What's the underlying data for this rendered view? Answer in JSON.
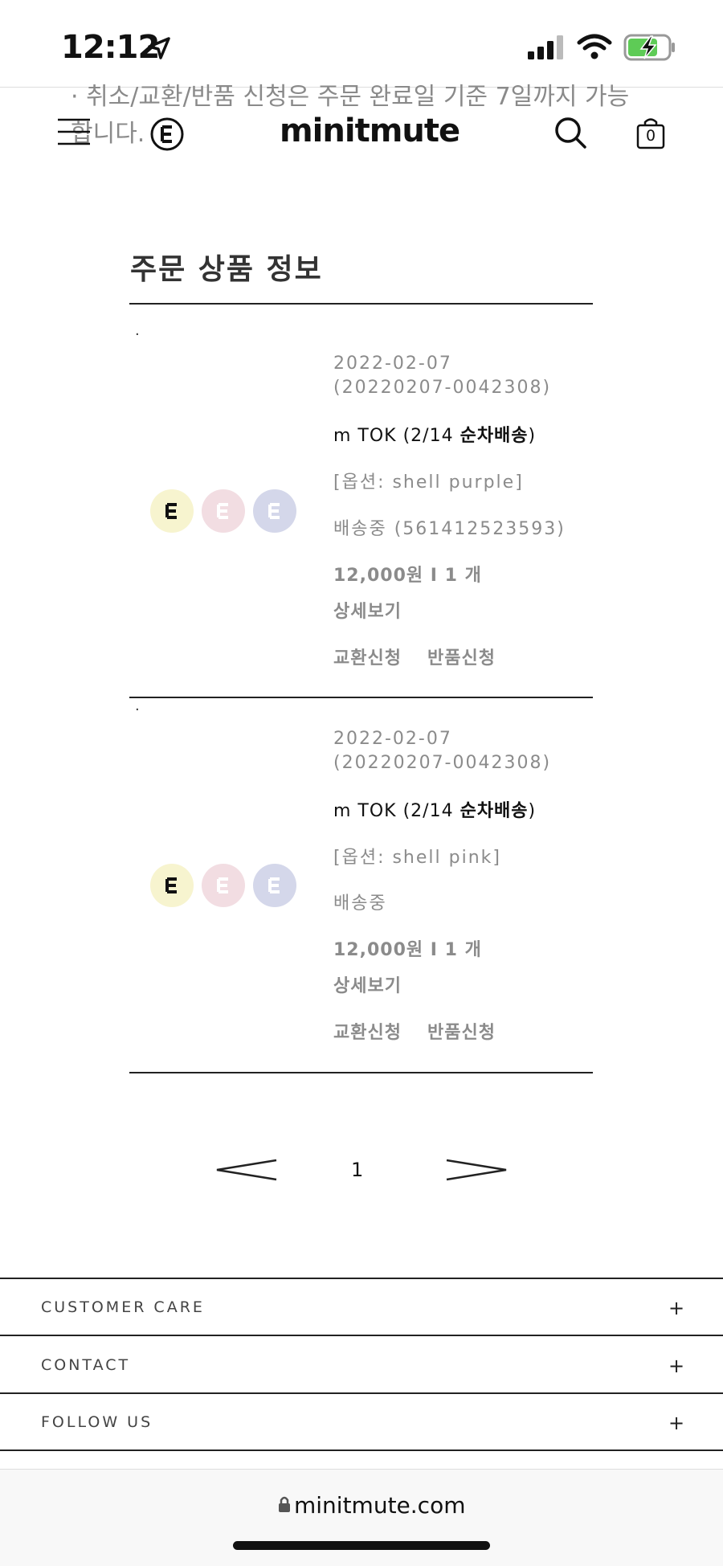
{
  "status_bar": {
    "time": "12:12"
  },
  "notice": {
    "text": "· 취소/교환/반품 신청은 주문 완료일 기준 7일까지 가능합니다."
  },
  "header": {
    "brand": "minitmute",
    "cart_count": "0"
  },
  "section": {
    "title": "주문 상품 정보"
  },
  "orders": [
    {
      "bullet": "·",
      "date": "2022-02-07",
      "order_no": "(20220207-0042308)",
      "name_prefix": "m TOK (2/14 ",
      "name_bold": "순차배송",
      "name_suffix": ")",
      "option": "[옵션: shell purple]",
      "status": "배송중 (561412523593)",
      "price_qty": "12,000원 I 1 개",
      "detail_label": "상세보기",
      "exchange_label": "교환신청",
      "return_label": "반품신청"
    },
    {
      "bullet": "·",
      "date": "2022-02-07",
      "order_no": "(20220207-0042308)",
      "name_prefix": "m TOK (2/14 ",
      "name_bold": "순차배송",
      "name_suffix": ")",
      "option": "[옵션: shell pink]",
      "status": "배송중",
      "price_qty": "12,000원 I 1 개",
      "detail_label": "상세보기",
      "exchange_label": "교환신청",
      "return_label": "반품신청"
    }
  ],
  "product_thumb": {
    "letter": "E",
    "colors": [
      "#f7f4cf",
      "#f2dde2",
      "#d4d7ea"
    ]
  },
  "pagination": {
    "current": "1"
  },
  "footer": {
    "items": [
      {
        "label": "CUSTOMER CARE",
        "icon": "+"
      },
      {
        "label": "CONTACT",
        "icon": "+"
      },
      {
        "label": "FOLLOW US",
        "icon": "+"
      }
    ]
  },
  "browser": {
    "url": "minitmute.com"
  }
}
